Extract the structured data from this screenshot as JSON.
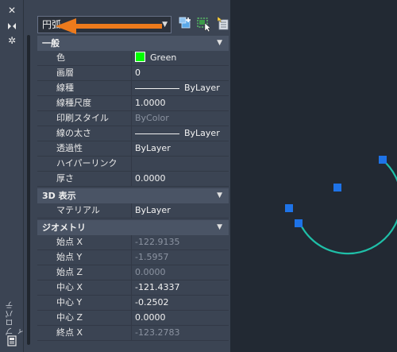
{
  "palette_title": "プロパティ",
  "object_selector": {
    "value": "円弧"
  },
  "colors": {
    "accent_arrow": "#ec7a1c",
    "arc": "#1fbfa8",
    "grip": "#1e73e8",
    "color_swatch": "#00ff00"
  },
  "toolbar_icons": [
    "close-icon",
    "autohide-icon",
    "settings-icon",
    "quick-select-icon",
    "select-objects-icon",
    "toggle-pickadd-icon"
  ],
  "sections": [
    {
      "title": "一般",
      "rows": [
        {
          "name": "色",
          "value": "Green"
        },
        {
          "name": "画層",
          "value": "0"
        },
        {
          "name": "線種",
          "value": "ByLayer"
        },
        {
          "name": "線種尺度",
          "value": "1.0000"
        },
        {
          "name": "印刷スタイル",
          "value": "ByColor"
        },
        {
          "name": "線の太さ",
          "value": "ByLayer"
        },
        {
          "name": "透過性",
          "value": "ByLayer"
        },
        {
          "name": "ハイパーリンク",
          "value": ""
        },
        {
          "name": "厚さ",
          "value": "0.0000"
        }
      ]
    },
    {
      "title": "3D 表示",
      "rows": [
        {
          "name": "マテリアル",
          "value": "ByLayer"
        }
      ]
    },
    {
      "title": "ジオメトリ",
      "rows": [
        {
          "name": "始点 X",
          "value": "-122.9135"
        },
        {
          "name": "始点 Y",
          "value": "-1.5957"
        },
        {
          "name": "始点 Z",
          "value": "0.0000"
        },
        {
          "name": "中心 X",
          "value": "-121.4337"
        },
        {
          "name": "中心 Y",
          "value": "-0.2502"
        },
        {
          "name": "中心 Z",
          "value": "0.0000"
        },
        {
          "name": "終点 X",
          "value": "-123.2783"
        }
      ]
    }
  ]
}
